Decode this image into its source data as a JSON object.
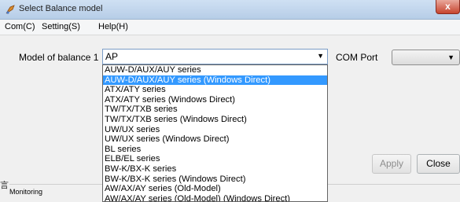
{
  "window": {
    "title": "Select Balance model",
    "close_label": "x"
  },
  "menu": {
    "items": [
      "Com(C)",
      "Setting(S)",
      "Help(H)"
    ]
  },
  "form": {
    "model_label": "Model of balance 1",
    "model_value": "AP",
    "com_label": "COM Port",
    "com_value": ""
  },
  "dropdown": {
    "selected_index": 1,
    "options": [
      "AUW-D/AUX/AUY series",
      "AUW-D/AUX/AUY series (Windows Direct)",
      "ATX/ATY series",
      "ATX/ATY series (Windows Direct)",
      "TW/TX/TXB series",
      "TW/TX/TXB series (Windows Direct)",
      "UW/UX series",
      "UW/UX series (Windows Direct)",
      "BL series",
      "ELB/EL series",
      "BW-K/BX-K series",
      "BW-K/BX-K series (Windows Direct)",
      "AW/AX/AY series (Old-Model)",
      "AW/AX/AY series (Old-Model) (Windows Direct)"
    ]
  },
  "buttons": {
    "apply": "Apply",
    "close": "Close"
  },
  "status": {
    "text": "Monitoring"
  },
  "left_edge_glyph": "言",
  "colors": {
    "selection": "#3399ff",
    "titlebar": "#b6cde7",
    "close_button": "#c7442e"
  },
  "icons": {
    "app": "balance-app-icon",
    "combo_arrow": "chevron-down-icon"
  }
}
